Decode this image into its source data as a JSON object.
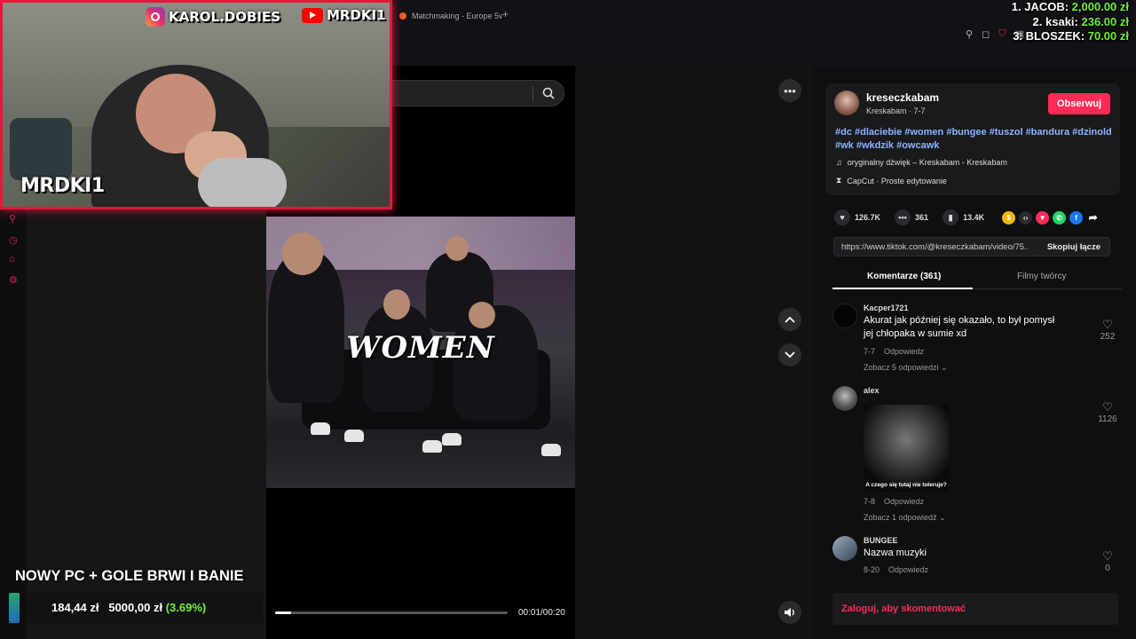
{
  "browser": {
    "tab_title": "Matchmaking - Europe 5v",
    "new_tab": "+"
  },
  "leaderboard": [
    {
      "rank_name": "1. JACOB:",
      "amount": "2,000.00 zł"
    },
    {
      "rank_name": "2. ksaki:",
      "amount": "236.00 zł"
    },
    {
      "rank_name": "3. BLOSZEK:",
      "amount": "70.00 zł"
    }
  ],
  "webcam": {
    "instagram": "KAROL.DOBIES",
    "youtube": "MRDKI1",
    "name": "MRDKI1"
  },
  "goal": {
    "title": "NOWY PC + GOLE BRWI I BANIE",
    "current": "184,44 zł",
    "target": "5000,00 zł",
    "percent": "(3.69%)"
  },
  "video": {
    "overlay_text": "WOMEN",
    "time": "00:01/00:20",
    "progress": 0.07
  },
  "post": {
    "username": "kreseczkabam",
    "subtitle": "Kreskabam · 7-7",
    "follow_label": "Obserwuj",
    "tags": "#dc #dlaciebie #women #bungee #tuszol #bandura #dzinold #wk #wkdzik #owcawk",
    "sound": "oryginalny dźwięk – Kreskabam - Kreskabam",
    "capcut": "CapCut · Proste edytowanie",
    "likes": "126.7K",
    "comments": "361",
    "saves": "13.4K",
    "url": "https://www.tiktok.com/@kreseczkabam/video/75...",
    "copy_label": "Skopiuj łącze"
  },
  "tabs": {
    "comments": "Komentarze (361)",
    "creator_videos": "Filmy twórcy"
  },
  "comments": [
    {
      "user": "Kacper1721",
      "text": "Akurat jak później się okazało, to był pomysł jej chłopaka w sumie xd",
      "date": "7-7",
      "reply": "Odpowiedz",
      "replies": "Zobacz 5 odpowiedzi",
      "likes": "252"
    },
    {
      "user": "alex",
      "image_caption": "A czego się tutaj nie toleruje?",
      "date": "7-8",
      "reply": "Odpowiedz",
      "replies": "Zobacz 1 odpowiedź",
      "likes": "1126"
    },
    {
      "user": "BUNGEE",
      "text": "Nazwa muzyki",
      "date": "8-20",
      "reply": "Odpowiedz",
      "likes": "0"
    }
  ],
  "login_prompt": "Zaloguj, aby skomentować",
  "colors": {
    "accent": "#fe2c55",
    "cam_border": "#e8163d",
    "money_green": "#6fef3a",
    "tag_blue": "#8ab4ff"
  }
}
